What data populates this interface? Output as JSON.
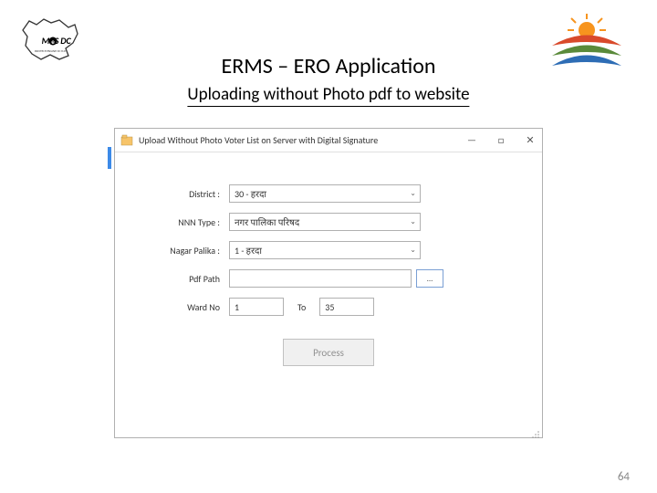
{
  "header": {
    "title": "ERMS – ERO Application",
    "subtitle": "Uploading without Photo pdf to website"
  },
  "window": {
    "title": "Upload Without Photo Voter List on Server with Digital Signature",
    "controls": {
      "minimize": "—",
      "maximize": "□",
      "close": "✕"
    }
  },
  "form": {
    "district": {
      "label": "District :",
      "value": "30 - हरदा"
    },
    "nnnType": {
      "label": "NNN Type :",
      "value": "नगर पालिका परिषद"
    },
    "nagarPalika": {
      "label": "Nagar Palika :",
      "value": "1 - हरदा"
    },
    "pdfPath": {
      "label": "Pdf Path",
      "value": "",
      "browse": "..."
    },
    "wardNo": {
      "label": "Ward No",
      "from": "1",
      "toLabel": "To",
      "to": "35"
    },
    "processBtn": "Process"
  },
  "pageNumber": "64"
}
